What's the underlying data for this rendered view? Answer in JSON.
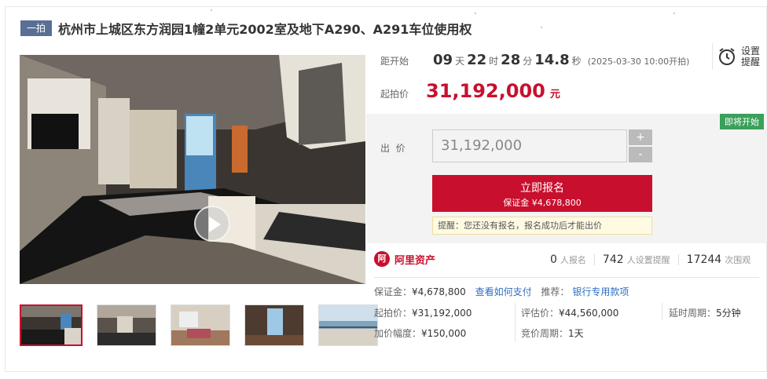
{
  "header": {
    "badge": "一拍",
    "title": "杭州市上城区东方润园1幢2单元2002室及地下A290、A291车位使用权"
  },
  "countdown": {
    "label": "距开始",
    "days": "09",
    "days_unit": "天",
    "hours": "22",
    "hours_unit": "时",
    "minutes": "28",
    "minutes_unit": "分",
    "seconds": "14.8",
    "seconds_unit": "秒",
    "start_note": "(2025-03-30 10:00开拍)"
  },
  "reminder": {
    "icon": "alarm-clock-icon",
    "line1": "设置",
    "line2": "提醒"
  },
  "starting_price": {
    "label": "起拍价",
    "value": "31,192,000",
    "unit": "元"
  },
  "bid": {
    "status_badge": "即将开始",
    "label": "出  价",
    "input_value": "31,192,000",
    "plus": "+",
    "minus": "-",
    "signup_label": "立即报名",
    "deposit_line": "保证金 ¥4,678,800",
    "tip": "提醒：您还没有报名，报名成功后才能出价"
  },
  "brand": {
    "logo_text": "阿",
    "name": "阿里资产"
  },
  "stats": {
    "signups": "0",
    "signups_label": "人报名",
    "reminders": "742",
    "reminders_label": "人设置提醒",
    "views": "17244",
    "views_label": "次围观"
  },
  "details": {
    "deposit_label": "保证金：",
    "deposit_value": "¥4,678,800",
    "how_to_pay": "查看如何支付",
    "recommend_label": "推荐：",
    "recommend_link": "银行专用款项",
    "start_price_label": "起拍价：",
    "start_price_value": "¥31,192,000",
    "appraisal_label": "评估价：",
    "appraisal_value": "¥44,560,000",
    "delay_label": "延时周期：",
    "delay_value": "5分钟",
    "increment_label": "加价幅度：",
    "increment_value": "¥150,000",
    "cycle_label": "竞价周期：",
    "cycle_value": "1天"
  },
  "colors": {
    "accent": "#c8102e",
    "badge_bg": "#5b6f95",
    "status_green": "#3aa05a",
    "link": "#2f6fc1"
  }
}
